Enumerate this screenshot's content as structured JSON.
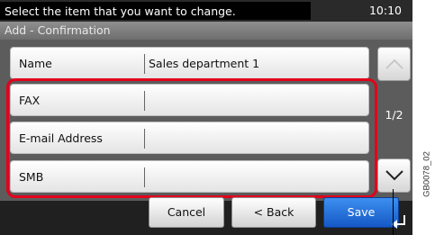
{
  "header": {
    "message": "Select the item that you want to change.",
    "time": "10:10"
  },
  "subtitle": "Add - Confirmation",
  "rows": [
    {
      "label": "Name",
      "value": "Sales department 1"
    },
    {
      "label": "FAX",
      "value": ""
    },
    {
      "label": "E-mail Address",
      "value": ""
    },
    {
      "label": "SMB",
      "value": ""
    }
  ],
  "pagination": {
    "indicator": "1/2"
  },
  "buttons": {
    "cancel": "Cancel",
    "back": "< Back",
    "save": "Save"
  },
  "figure_code": "GB0078_02",
  "colors": {
    "highlight": "#e3001b",
    "save_button": "#1f6fe0"
  },
  "icons": [
    "chevron-up-icon",
    "chevron-down-icon",
    "enter-arrow-icon"
  ]
}
